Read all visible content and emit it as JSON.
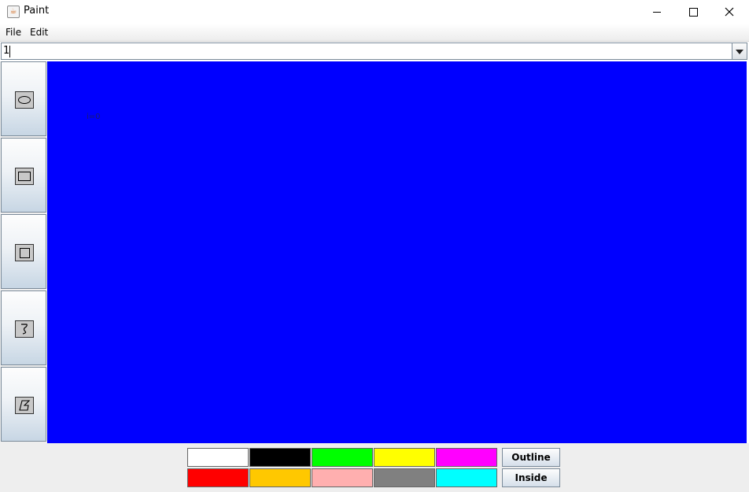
{
  "window": {
    "title": "Paint",
    "app_icon": "java-cup-icon",
    "controls": [
      "minimize-icon",
      "maximize-icon",
      "close-icon"
    ]
  },
  "menu": {
    "file": "File",
    "edit": "Edit"
  },
  "combo": {
    "value": "1"
  },
  "tools": [
    "ellipse-icon",
    "rectangle-icon",
    "square-icon",
    "freehand-icon",
    "polygon-icon"
  ],
  "canvas": {
    "background": "#0000ff",
    "text": "i=0"
  },
  "palette": {
    "colors": [
      "#ffffff",
      "#000000",
      "#00ff00",
      "#ffff00",
      "#ff00ff",
      "#ff0000",
      "#ffc800",
      "#ffafaf",
      "#808080",
      "#00ffff"
    ]
  },
  "fill_mode": {
    "outline": "Outline",
    "inside": "Inside"
  }
}
